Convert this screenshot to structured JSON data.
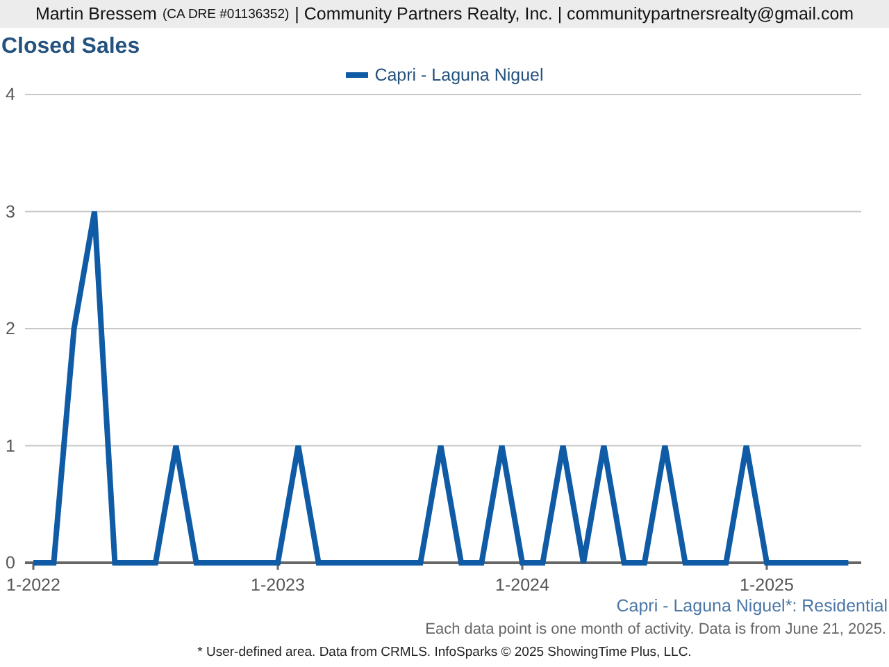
{
  "header": {
    "agent": "Martin Bressem",
    "license": "(CA DRE #01136352)",
    "rest": "| Community Partners Realty, Inc. | communitypartnersrealty@gmail.com"
  },
  "title": "Closed Sales",
  "chart_data": {
    "type": "line",
    "categories": [
      "1-2022",
      null,
      null,
      null,
      null,
      null,
      null,
      null,
      null,
      null,
      null,
      null,
      "1-2023",
      null,
      null,
      null,
      null,
      null,
      null,
      null,
      null,
      null,
      null,
      null,
      "1-2024",
      null,
      null,
      null,
      null,
      null,
      null,
      null,
      null,
      null,
      null,
      null,
      "1-2025",
      null,
      null,
      null,
      null
    ],
    "series": [
      {
        "name": "Capri - Laguna Niguel",
        "color": "#0f5ba5",
        "values": [
          0,
          0,
          2,
          3,
          0,
          0,
          0,
          1,
          0,
          0,
          0,
          0,
          0,
          1,
          0,
          0,
          0,
          0,
          0,
          0,
          1,
          0,
          0,
          1,
          0,
          0,
          1,
          0,
          1,
          0,
          0,
          1,
          0,
          0,
          0,
          1,
          0,
          0,
          0,
          0,
          0
        ]
      }
    ],
    "yticks": [
      0,
      1,
      2,
      3,
      4
    ],
    "ylim": [
      0,
      4
    ],
    "grid": true
  },
  "area_note": "Capri - Laguna Niguel*: Residential",
  "data_note": "Each data point is one month of activity. Data is from June 21, 2025.",
  "footer": "* User-defined area. Data from CRMLS. InfoSparks © 2025 ShowingTime Plus, LLC."
}
